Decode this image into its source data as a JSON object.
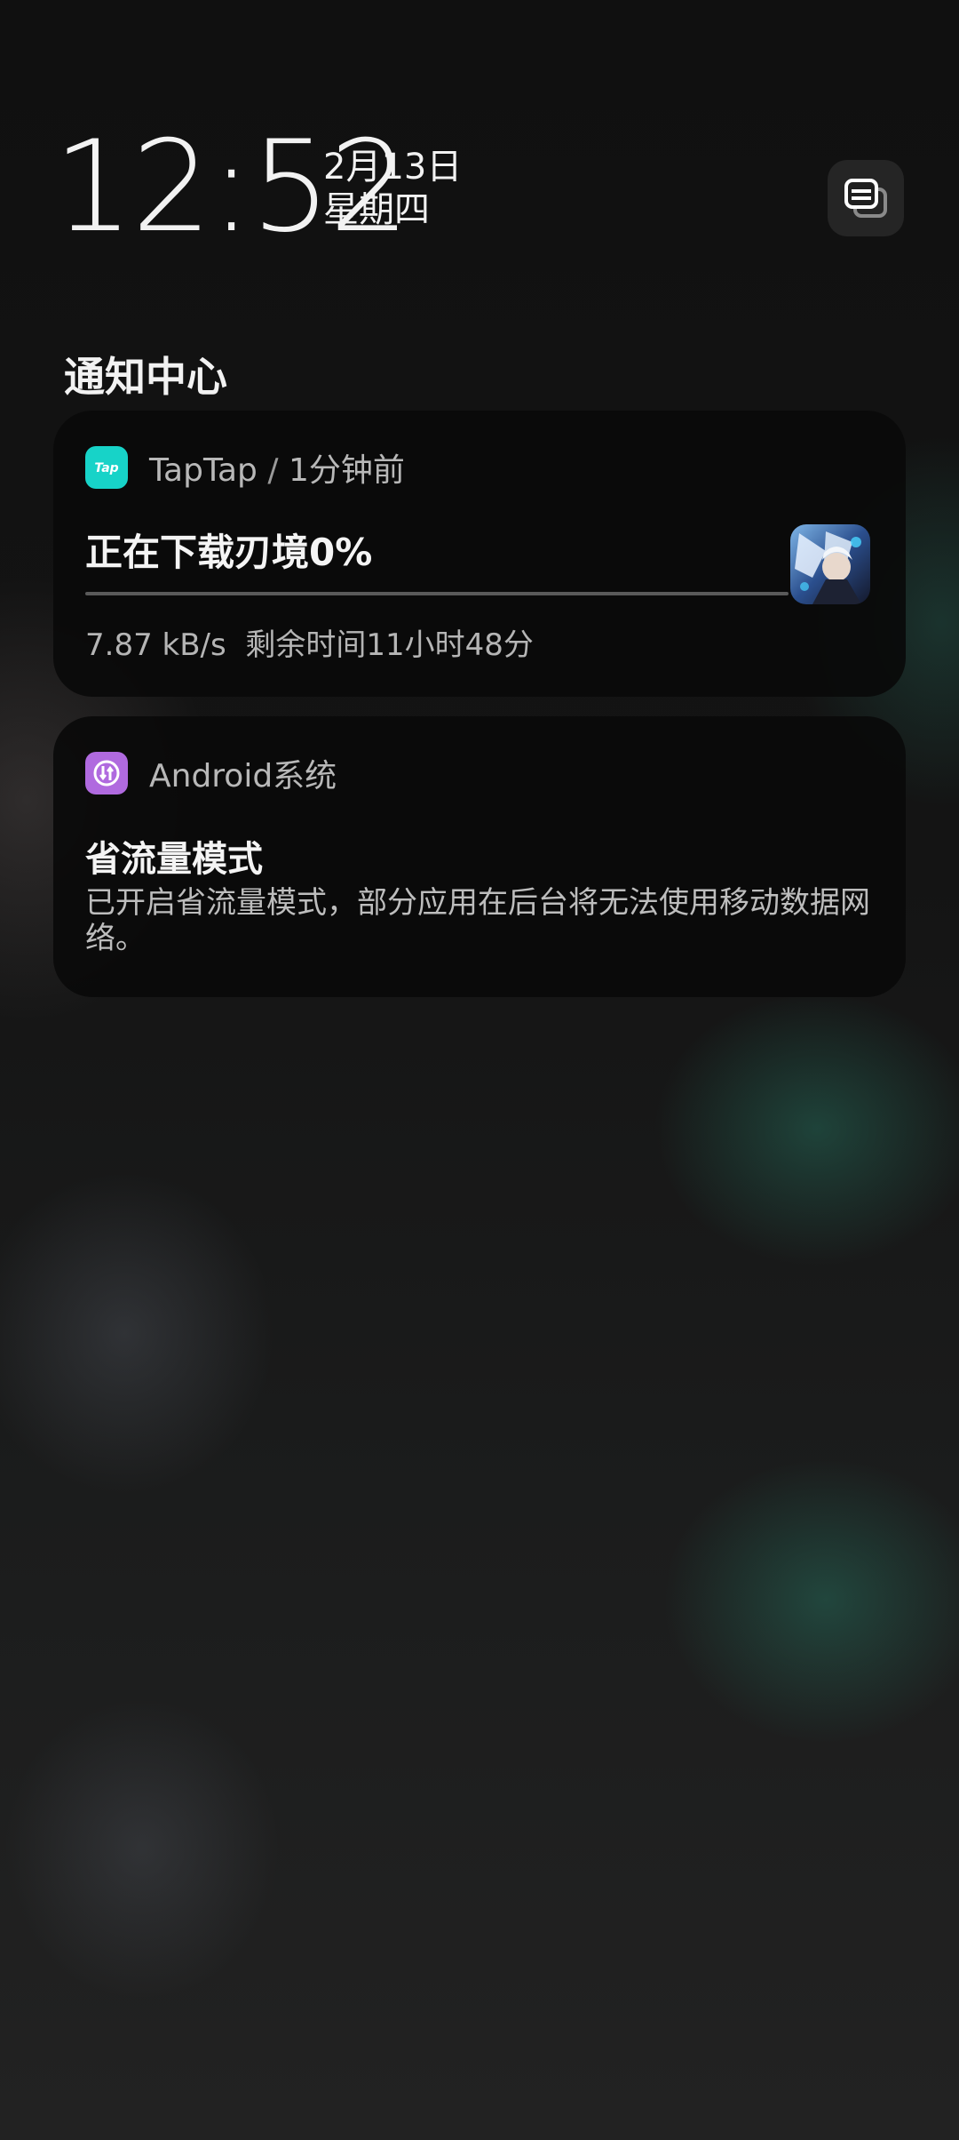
{
  "lockscreen": {
    "time": "12:52",
    "date": "2月13日",
    "weekday": "星期四",
    "manage_icon": "notification-manage-icon"
  },
  "notification_center": {
    "title": "通知中心",
    "notifications": [
      {
        "app_icon": "taptap-icon",
        "app_name": "TapTap",
        "separator": "/",
        "time_ago": "1分钟前",
        "title": "正在下载刃境0%",
        "progress": 0.0,
        "speed": "7.87 kB/s",
        "remaining": "剩余时间11小时48分",
        "thumbnail": "game-thumbnail"
      },
      {
        "app_icon": "android-system-icon",
        "app_name": "Android系统",
        "title": "省流量模式",
        "body": "已开启省流量模式，部分应用在后台将无法使用移动数据网络。"
      }
    ]
  },
  "colors": {
    "taptap_brand": "#17d3c8",
    "android_system_brand": "#b06adf"
  }
}
